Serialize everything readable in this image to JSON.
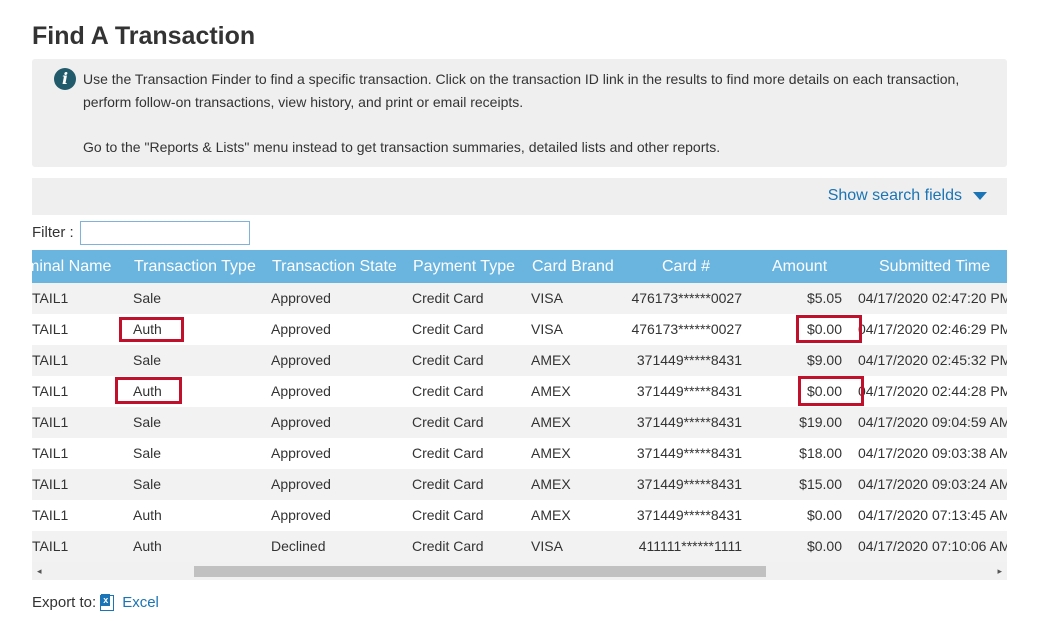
{
  "page": {
    "title": "Find A Transaction"
  },
  "info": {
    "icon": "info-icon",
    "text1": "Use the Transaction Finder to find a specific transaction. Click on the transaction ID link in the results to find more details on each transaction, perform follow-on transactions, view history, and print or email receipts.",
    "text2": "Go to the \"Reports & Lists\" menu instead to get transaction summaries, detailed lists and other reports."
  },
  "search": {
    "toggle_label": "Show search fields",
    "toggle_icon": "caret-down-icon"
  },
  "filter": {
    "label": "Filter :",
    "value": ""
  },
  "table": {
    "headers": [
      "minal Name",
      "Transaction Type",
      "Transaction State",
      "Payment Type",
      "Card Brand",
      "Card #",
      "Amount",
      "Submitted Time"
    ],
    "rows": [
      {
        "terminal": "TAIL1",
        "type": "Sale",
        "state": "Approved",
        "payment": "Credit Card",
        "brand": "VISA",
        "card": "476173******0027",
        "amount": "$5.05",
        "time": "04/17/2020 02:47:20 PM"
      },
      {
        "terminal": "TAIL1",
        "type": "Auth",
        "state": "Approved",
        "payment": "Credit Card",
        "brand": "VISA",
        "card": "476173******0027",
        "amount": "$0.00",
        "time": "04/17/2020 02:46:29 PM"
      },
      {
        "terminal": "TAIL1",
        "type": "Sale",
        "state": "Approved",
        "payment": "Credit Card",
        "brand": "AMEX",
        "card": "371449*****8431",
        "amount": "$9.00",
        "time": "04/17/2020 02:45:32 PM"
      },
      {
        "terminal": "TAIL1",
        "type": "Auth",
        "state": "Approved",
        "payment": "Credit Card",
        "brand": "AMEX",
        "card": "371449*****8431",
        "amount": "$0.00",
        "time": "04/17/2020 02:44:28 PM"
      },
      {
        "terminal": "TAIL1",
        "type": "Sale",
        "state": "Approved",
        "payment": "Credit Card",
        "brand": "AMEX",
        "card": "371449*****8431",
        "amount": "$19.00",
        "time": "04/17/2020 09:04:59 AM"
      },
      {
        "terminal": "TAIL1",
        "type": "Sale",
        "state": "Approved",
        "payment": "Credit Card",
        "brand": "AMEX",
        "card": "371449*****8431",
        "amount": "$18.00",
        "time": "04/17/2020 09:03:38 AM"
      },
      {
        "terminal": "TAIL1",
        "type": "Sale",
        "state": "Approved",
        "payment": "Credit Card",
        "brand": "AMEX",
        "card": "371449*****8431",
        "amount": "$15.00",
        "time": "04/17/2020 09:03:24 AM"
      },
      {
        "terminal": "TAIL1",
        "type": "Auth",
        "state": "Approved",
        "payment": "Credit Card",
        "brand": "AMEX",
        "card": "371449*****8431",
        "amount": "$0.00",
        "time": "04/17/2020 07:13:45 AM"
      },
      {
        "terminal": "TAIL1",
        "type": "Auth",
        "state": "Declined",
        "payment": "Credit Card",
        "brand": "VISA",
        "card": "411111******1111",
        "amount": "$0.00",
        "time": "04/17/2020 07:10:06 AM"
      }
    ],
    "highlight_color": "#c0102c"
  },
  "scrollbar": {
    "left_arrow": "◂",
    "right_arrow": "▸"
  },
  "export": {
    "label": "Export to:",
    "icon": "excel-icon",
    "link_label": "Excel"
  },
  "colors": {
    "header_bg": "#6ab4e0",
    "link": "#1a74b5",
    "info_icon": "#215a6b"
  }
}
